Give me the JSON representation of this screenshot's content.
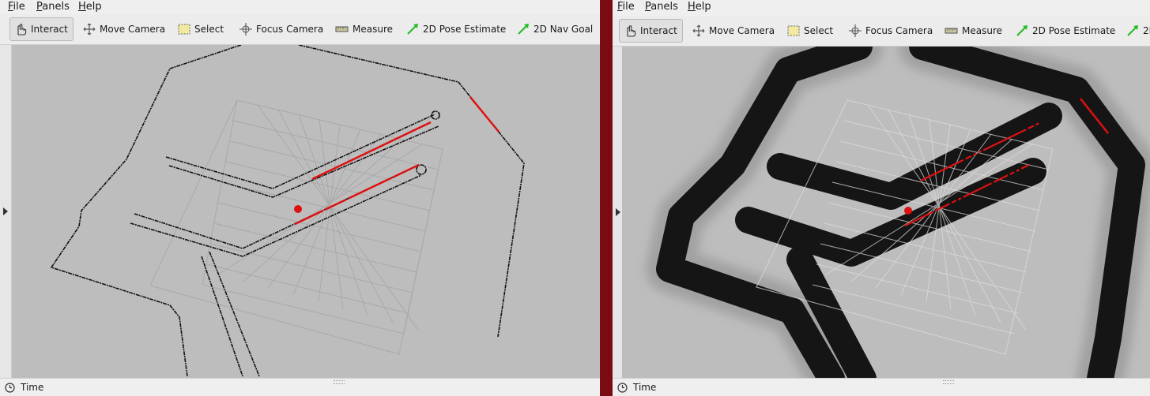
{
  "menus": [
    {
      "accel": "F",
      "rest": "ile"
    },
    {
      "accel": "P",
      "rest": "anels"
    },
    {
      "accel": "H",
      "rest": "elp"
    }
  ],
  "tools": {
    "interact": "Interact",
    "move_camera": "Move Camera",
    "select": "Select",
    "focus_camera": "Focus Camera",
    "measure": "Measure",
    "pose_estimate": "2D Pose Estimate",
    "nav_goal": "2D Nav Goal",
    "nav_goal_truncated": "2I"
  },
  "status": {
    "time_label": "Time"
  },
  "colors": {
    "divider": "#7a0a14",
    "map_background": "#bdbdbd",
    "laser_scan": "#dd1111",
    "grid": "#a9a9a9",
    "inflation": "#151515",
    "tool_arrow": "#22bb22"
  },
  "icons": {
    "interact": "hand-pointer-icon",
    "move_camera": "move-arrows-icon",
    "select": "selection-box-icon",
    "focus_camera": "focus-target-icon",
    "measure": "ruler-icon",
    "pose_estimate": "green-arrow-icon",
    "nav_goal": "green-arrow-icon",
    "time": "clock-icon"
  }
}
